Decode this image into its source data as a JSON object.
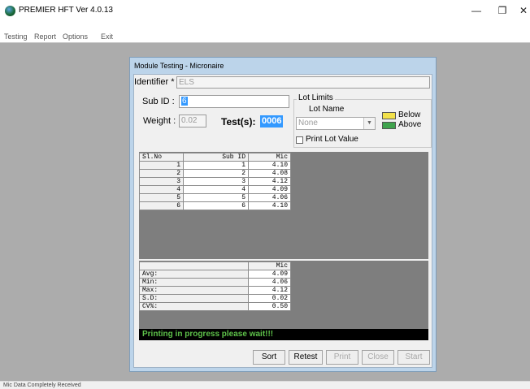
{
  "app": {
    "title": "PREMIER HFT  Ver 4.0.13",
    "window_controls": {
      "minimize": "—",
      "maximize": "❐",
      "close": "✕"
    }
  },
  "menu": {
    "items": [
      "Testing",
      "Report",
      "Options",
      "Exit"
    ]
  },
  "dialog": {
    "title": "Module Testing - Micronaire",
    "identifier": {
      "label": "Identifier * :",
      "value": "ELS"
    },
    "sub_id": {
      "label": "Sub ID :",
      "value": "6"
    },
    "weight": {
      "label": "Weight :",
      "value": "0.02"
    },
    "tests": {
      "label": "Test(s):",
      "value": "0006"
    },
    "lot_limits": {
      "legend": "Lot Limits",
      "lot_name_label": "Lot Name",
      "lot_name_value": "None",
      "below_label": "Below",
      "above_label": "Above",
      "below_color": "#f2e14a",
      "above_color": "#3fa34d",
      "print_lot_value_label": "Print Lot Value",
      "print_lot_value_checked": false
    },
    "results_grid": {
      "headers": [
        "Sl.No",
        "Sub ID",
        "Mic"
      ],
      "rows": [
        [
          "1",
          "1",
          "4.10"
        ],
        [
          "2",
          "2",
          "4.08"
        ],
        [
          "3",
          "3",
          "4.12"
        ],
        [
          "4",
          "4",
          "4.09"
        ],
        [
          "5",
          "5",
          "4.06"
        ],
        [
          "6",
          "6",
          "4.10"
        ]
      ]
    },
    "stats_grid": {
      "headers": [
        "",
        "Mic"
      ],
      "rows": [
        [
          "Avg:",
          "4.09"
        ],
        [
          "Min:",
          "4.06"
        ],
        [
          "Max:",
          "4.12"
        ],
        [
          "S.D:",
          "0.02"
        ],
        [
          "CV%:",
          "0.50"
        ]
      ]
    },
    "status_message": "Printing in progress please wait!!!",
    "buttons": {
      "sort": "Sort",
      "retest": "Retest",
      "print": "Print",
      "close": "Close",
      "start": "Start"
    }
  },
  "statusbar": {
    "text": "Mic Data Completely Received"
  }
}
